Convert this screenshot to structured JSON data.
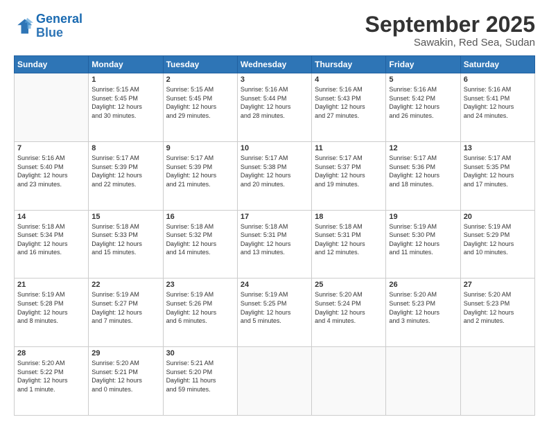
{
  "header": {
    "logo_line1": "General",
    "logo_line2": "Blue",
    "month": "September 2025",
    "location": "Sawakin, Red Sea, Sudan"
  },
  "days_of_week": [
    "Sunday",
    "Monday",
    "Tuesday",
    "Wednesday",
    "Thursday",
    "Friday",
    "Saturday"
  ],
  "weeks": [
    [
      {
        "day": "",
        "info": ""
      },
      {
        "day": "1",
        "info": "Sunrise: 5:15 AM\nSunset: 5:45 PM\nDaylight: 12 hours\nand 30 minutes."
      },
      {
        "day": "2",
        "info": "Sunrise: 5:15 AM\nSunset: 5:45 PM\nDaylight: 12 hours\nand 29 minutes."
      },
      {
        "day": "3",
        "info": "Sunrise: 5:16 AM\nSunset: 5:44 PM\nDaylight: 12 hours\nand 28 minutes."
      },
      {
        "day": "4",
        "info": "Sunrise: 5:16 AM\nSunset: 5:43 PM\nDaylight: 12 hours\nand 27 minutes."
      },
      {
        "day": "5",
        "info": "Sunrise: 5:16 AM\nSunset: 5:42 PM\nDaylight: 12 hours\nand 26 minutes."
      },
      {
        "day": "6",
        "info": "Sunrise: 5:16 AM\nSunset: 5:41 PM\nDaylight: 12 hours\nand 24 minutes."
      }
    ],
    [
      {
        "day": "7",
        "info": "Sunrise: 5:16 AM\nSunset: 5:40 PM\nDaylight: 12 hours\nand 23 minutes."
      },
      {
        "day": "8",
        "info": "Sunrise: 5:17 AM\nSunset: 5:39 PM\nDaylight: 12 hours\nand 22 minutes."
      },
      {
        "day": "9",
        "info": "Sunrise: 5:17 AM\nSunset: 5:39 PM\nDaylight: 12 hours\nand 21 minutes."
      },
      {
        "day": "10",
        "info": "Sunrise: 5:17 AM\nSunset: 5:38 PM\nDaylight: 12 hours\nand 20 minutes."
      },
      {
        "day": "11",
        "info": "Sunrise: 5:17 AM\nSunset: 5:37 PM\nDaylight: 12 hours\nand 19 minutes."
      },
      {
        "day": "12",
        "info": "Sunrise: 5:17 AM\nSunset: 5:36 PM\nDaylight: 12 hours\nand 18 minutes."
      },
      {
        "day": "13",
        "info": "Sunrise: 5:17 AM\nSunset: 5:35 PM\nDaylight: 12 hours\nand 17 minutes."
      }
    ],
    [
      {
        "day": "14",
        "info": "Sunrise: 5:18 AM\nSunset: 5:34 PM\nDaylight: 12 hours\nand 16 minutes."
      },
      {
        "day": "15",
        "info": "Sunrise: 5:18 AM\nSunset: 5:33 PM\nDaylight: 12 hours\nand 15 minutes."
      },
      {
        "day": "16",
        "info": "Sunrise: 5:18 AM\nSunset: 5:32 PM\nDaylight: 12 hours\nand 14 minutes."
      },
      {
        "day": "17",
        "info": "Sunrise: 5:18 AM\nSunset: 5:31 PM\nDaylight: 12 hours\nand 13 minutes."
      },
      {
        "day": "18",
        "info": "Sunrise: 5:18 AM\nSunset: 5:31 PM\nDaylight: 12 hours\nand 12 minutes."
      },
      {
        "day": "19",
        "info": "Sunrise: 5:19 AM\nSunset: 5:30 PM\nDaylight: 12 hours\nand 11 minutes."
      },
      {
        "day": "20",
        "info": "Sunrise: 5:19 AM\nSunset: 5:29 PM\nDaylight: 12 hours\nand 10 minutes."
      }
    ],
    [
      {
        "day": "21",
        "info": "Sunrise: 5:19 AM\nSunset: 5:28 PM\nDaylight: 12 hours\nand 8 minutes."
      },
      {
        "day": "22",
        "info": "Sunrise: 5:19 AM\nSunset: 5:27 PM\nDaylight: 12 hours\nand 7 minutes."
      },
      {
        "day": "23",
        "info": "Sunrise: 5:19 AM\nSunset: 5:26 PM\nDaylight: 12 hours\nand 6 minutes."
      },
      {
        "day": "24",
        "info": "Sunrise: 5:19 AM\nSunset: 5:25 PM\nDaylight: 12 hours\nand 5 minutes."
      },
      {
        "day": "25",
        "info": "Sunrise: 5:20 AM\nSunset: 5:24 PM\nDaylight: 12 hours\nand 4 minutes."
      },
      {
        "day": "26",
        "info": "Sunrise: 5:20 AM\nSunset: 5:23 PM\nDaylight: 12 hours\nand 3 minutes."
      },
      {
        "day": "27",
        "info": "Sunrise: 5:20 AM\nSunset: 5:23 PM\nDaylight: 12 hours\nand 2 minutes."
      }
    ],
    [
      {
        "day": "28",
        "info": "Sunrise: 5:20 AM\nSunset: 5:22 PM\nDaylight: 12 hours\nand 1 minute."
      },
      {
        "day": "29",
        "info": "Sunrise: 5:20 AM\nSunset: 5:21 PM\nDaylight: 12 hours\nand 0 minutes."
      },
      {
        "day": "30",
        "info": "Sunrise: 5:21 AM\nSunset: 5:20 PM\nDaylight: 11 hours\nand 59 minutes."
      },
      {
        "day": "",
        "info": ""
      },
      {
        "day": "",
        "info": ""
      },
      {
        "day": "",
        "info": ""
      },
      {
        "day": "",
        "info": ""
      }
    ]
  ]
}
